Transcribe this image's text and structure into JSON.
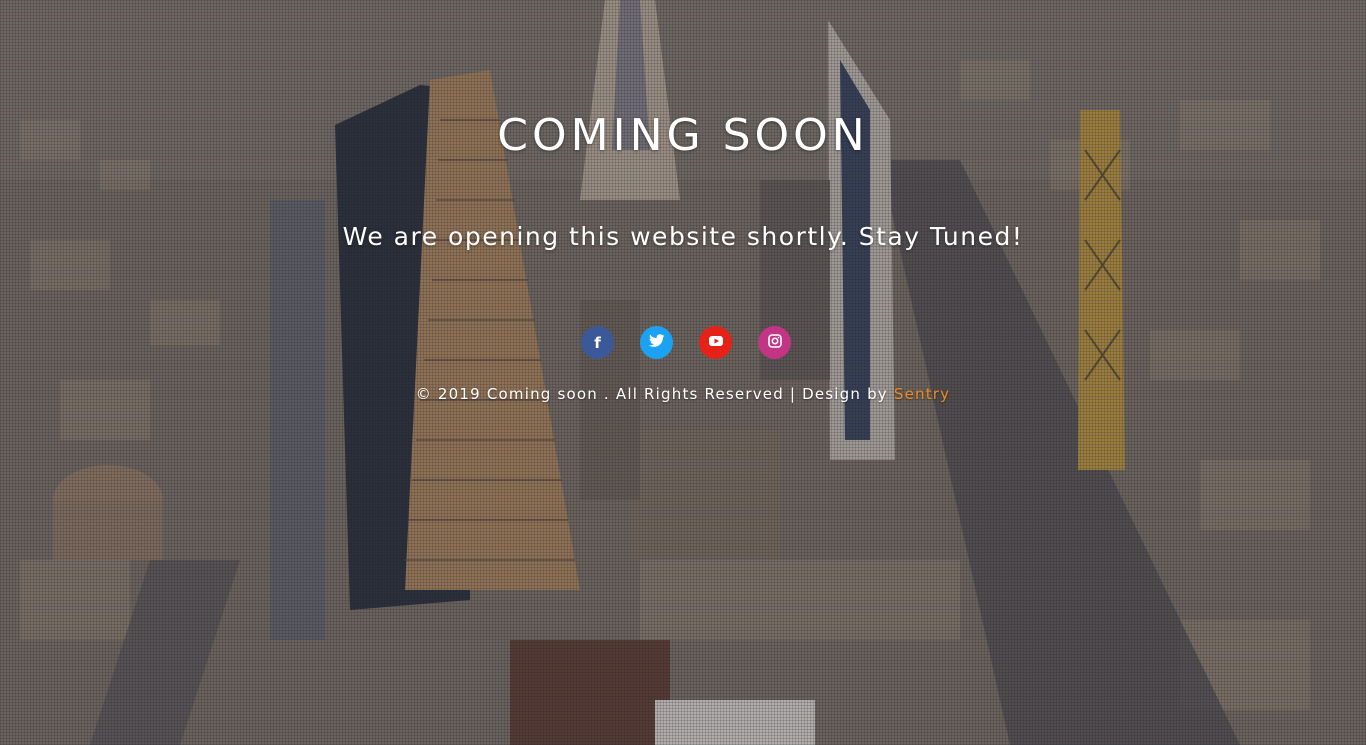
{
  "page": {
    "title": "COMING SOON",
    "subtitle": "We are opening this website shortly. Stay Tuned!"
  },
  "social": [
    {
      "name": "facebook",
      "icon": "facebook-icon",
      "glyph": "f",
      "color": "#3b5998"
    },
    {
      "name": "twitter",
      "icon": "twitter-icon",
      "glyph": "t",
      "color": "#1da1f2"
    },
    {
      "name": "youtube",
      "icon": "youtube-icon",
      "glyph": "▶",
      "color": "#e62117"
    },
    {
      "name": "instagram",
      "icon": "instagram-icon",
      "glyph": "◎",
      "color": "#c13584"
    }
  ],
  "footer": {
    "text": "© 2019 Coming soon . All Rights Reserved | Design by ",
    "brand": "Sentry",
    "brand_color": "#f08a24"
  }
}
